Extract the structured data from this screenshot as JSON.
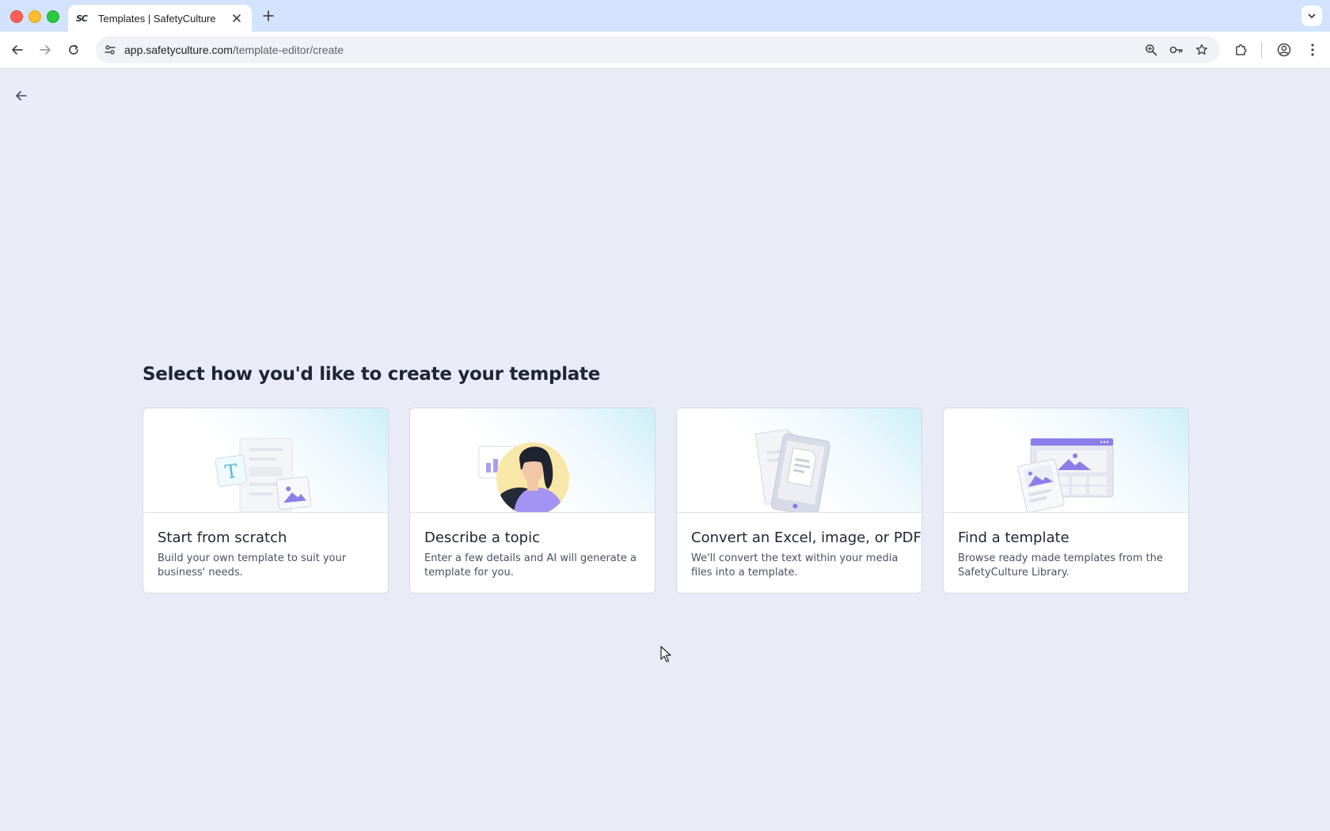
{
  "browser": {
    "tab": {
      "favicon": "SC",
      "title": "Templates | SafetyCulture"
    },
    "url": {
      "host": "app.safetyculture.com",
      "path": "/template-editor/create"
    },
    "icons": {
      "back": "arrow-left-icon",
      "forward": "arrow-right-icon",
      "reload": "reload-icon",
      "site_settings": "tune-icon",
      "zoom": "zoom-icon",
      "passwords": "key-icon",
      "bookmark": "star-icon",
      "extensions": "puzzle-icon",
      "profile": "profile-icon",
      "menu": "kebab-icon"
    }
  },
  "page": {
    "heading": "Select how you'd like to create your template",
    "cards": [
      {
        "title": "Start from scratch",
        "description": "Build your own template to suit your business' needs.",
        "illustration": "blank-form-illustration"
      },
      {
        "title": "Describe a topic",
        "description": "Enter a few details and AI will generate a template for you.",
        "illustration": "person-chart-illustration"
      },
      {
        "title": "Convert an Excel, image, or PDF",
        "description": "We'll convert the text within your media files into a template.",
        "illustration": "document-convert-illustration"
      },
      {
        "title": "Find a template",
        "description": "Browse ready made templates from the SafetyCulture Library.",
        "illustration": "template-library-illustration"
      }
    ]
  },
  "colors": {
    "page_bg": "#e9ebf6",
    "accent_purple": "#8b7ee8",
    "text_dark": "#1f2533"
  }
}
